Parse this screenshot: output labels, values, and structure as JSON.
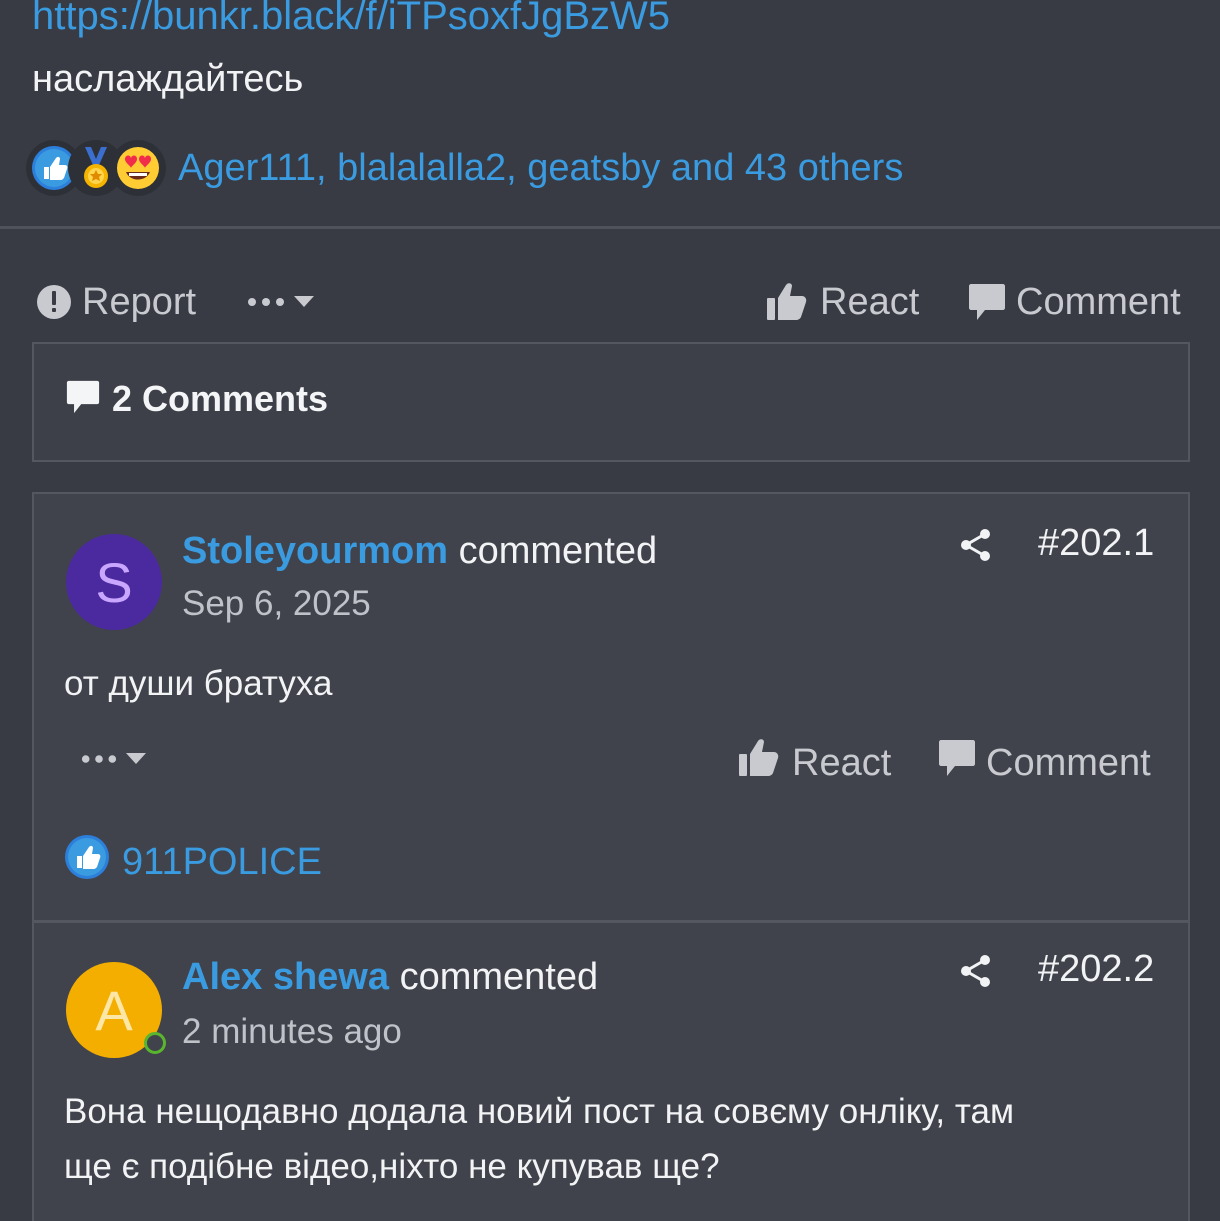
{
  "post": {
    "link": "https://bunkr.black/f/iTPsoxfJgBzW5",
    "text": "наслаждайтесь",
    "reactors": "Ager111, blalalalla2, geatsby and 43 others",
    "reaction_icons": [
      "like-icon",
      "medal-icon",
      "heart-eyes-icon"
    ]
  },
  "actions": {
    "report": "Report",
    "react": "React",
    "comment": "Comment"
  },
  "comments_header": {
    "title": "2 Comments"
  },
  "comments": [
    {
      "avatar_letter": "S",
      "avatar_color": "#4a2a9e",
      "avatar_letter_color": "#c9a6ff",
      "user": "Stoleyourmom",
      "verb": "commented",
      "date": "Sep 6, 2025",
      "number": "#202.1",
      "body": "от души братуха",
      "react": "React",
      "comment": "Comment",
      "reactor": "911POLICE"
    },
    {
      "avatar_letter": "A",
      "avatar_color": "#f4ae00",
      "avatar_letter_color": "#fde7a6",
      "user": "Alex shewa",
      "verb": "commented",
      "date": "2 minutes ago",
      "number": "#202.2",
      "body_line1": "Вона нещодавно додала новий пост на совєму онліку, там",
      "body_line2": "ще є подібне відео,ніхто не купував ще?"
    }
  ],
  "colors": {
    "background": "#383b44",
    "link": "#3a9be0",
    "panel": "#40434b",
    "border": "#54575f"
  }
}
